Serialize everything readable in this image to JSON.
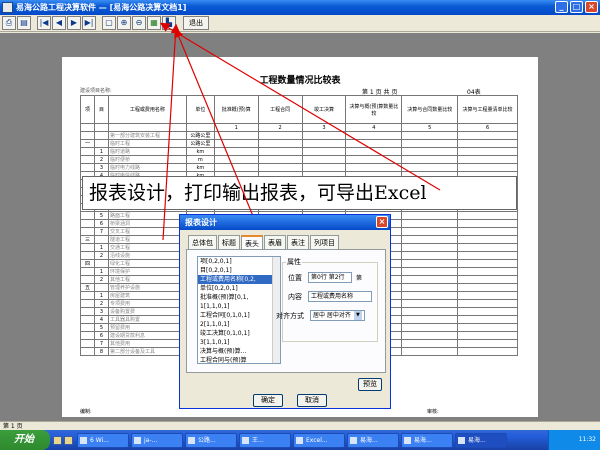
{
  "window": {
    "title": "易海公路工程决算软件 — [易海公路决算文档1]",
    "controls": [
      "_",
      "□",
      "×"
    ]
  },
  "toolbar": {
    "buttons": [
      {
        "name": "print-button",
        "glyph": "⎙"
      },
      {
        "name": "printer-setup-button",
        "glyph": "▤"
      },
      {
        "name": "first-page-button",
        "glyph": "|◀"
      },
      {
        "name": "prev-page-button",
        "glyph": "◀"
      },
      {
        "name": "next-page-button",
        "glyph": "▶"
      },
      {
        "name": "last-page-button",
        "glyph": "▶|"
      },
      {
        "name": "page-view-button",
        "glyph": "▢"
      },
      {
        "name": "zoom-in-button",
        "glyph": "⊕"
      },
      {
        "name": "zoom-out-button",
        "glyph": "⊖"
      },
      {
        "name": "export-excel-button",
        "glyph": "▦"
      },
      {
        "name": "report-design-button",
        "glyph": "▙"
      }
    ],
    "exit_label": "退出"
  },
  "report": {
    "title": "工程数量情况比较表",
    "subtitle": "第 1 页 共 页",
    "unit": "04表",
    "left_note": "建设项目名称:",
    "headers": [
      "项",
      "目",
      "工程或费用名称",
      "单位",
      "批准概(预)算",
      "工程合同",
      "竣工决算",
      "决算与概(预)算数量比较",
      "决算与合同数量比较",
      "决算与工程量清单比较"
    ],
    "col_numbers": [
      "",
      "",
      "",
      "",
      "1",
      "2",
      "3",
      "4",
      "5",
      "6"
    ],
    "rows": [
      [
        "",
        "",
        "第一部分建筑安装工程",
        "公路公里",
        "",
        "",
        "",
        "",
        "",
        ""
      ],
      [
        "一",
        "",
        "临时工程",
        "公路公里",
        "",
        "",
        "",
        "",
        "",
        ""
      ],
      [
        "",
        "1",
        "临时道路",
        "km",
        "",
        "",
        "",
        "",
        "",
        ""
      ],
      [
        "",
        "2",
        "临时便桥",
        "m",
        "",
        "",
        "",
        "",
        "",
        ""
      ],
      [
        "",
        "3",
        "临时电力线路",
        "km",
        "",
        "",
        "",
        "",
        "",
        ""
      ],
      [
        "",
        "4",
        "临时电信线路",
        "km",
        "",
        "",
        "",
        "",
        "",
        ""
      ]
    ],
    "lower_rows": [
      [
        "",
        "5",
        "路面工程",
        "",
        "",
        "",
        "",
        "",
        "",
        ""
      ],
      [
        "",
        "6",
        "桥梁涵洞",
        "",
        "",
        "",
        "",
        "",
        "",
        ""
      ],
      [
        "",
        "7",
        "交叉工程",
        "",
        "",
        "",
        "",
        "",
        "",
        ""
      ],
      [
        "三",
        "",
        "隧道工程",
        "",
        "",
        "",
        "",
        "",
        "",
        ""
      ],
      [
        "",
        "1",
        "交通工程",
        "",
        "",
        "",
        "",
        "",
        "",
        ""
      ],
      [
        "",
        "2",
        "沿线设施",
        "",
        "",
        "",
        "",
        "",
        "",
        ""
      ],
      [
        "四",
        "",
        "绿化工程",
        "",
        "",
        "",
        "",
        "",
        "",
        ""
      ],
      [
        "",
        "1",
        "环境保护",
        "",
        "",
        "",
        "",
        "",
        "",
        ""
      ],
      [
        "",
        "2",
        "其他工程",
        "",
        "",
        "",
        "",
        "",
        "",
        ""
      ],
      [
        "五",
        "",
        "管理养护设施",
        "",
        "",
        "",
        "",
        "",
        "",
        ""
      ],
      [
        "",
        "1",
        "房屋建筑",
        "",
        "",
        "",
        "",
        "",
        "",
        ""
      ],
      [
        "",
        "2",
        "专项费用",
        "",
        "",
        "",
        "",
        "",
        "",
        ""
      ],
      [
        "",
        "3",
        "设备购置费",
        "",
        "",
        "",
        "",
        "",
        "",
        ""
      ],
      [
        "",
        "4",
        "工具器具购置",
        "",
        "",
        "",
        "",
        "",
        "",
        ""
      ],
      [
        "",
        "5",
        "预留费用",
        "",
        "",
        "",
        "",
        "",
        "",
        ""
      ],
      [
        "",
        "6",
        "建设期贷款利息",
        "",
        "",
        "",
        "",
        "",
        "",
        ""
      ],
      [
        "",
        "7",
        "其他费用",
        "",
        "",
        "",
        "",
        "",
        "",
        ""
      ],
      [
        "",
        "8",
        "第二部分设备及工具",
        "",
        "",
        "",
        "",
        "",
        "",
        ""
      ]
    ],
    "footer_left": "编制:",
    "footer_right": "审核:"
  },
  "banner": {
    "text": "报表设计，打印输出报表，可导出Excel"
  },
  "dialog": {
    "title": "报表设计",
    "close": "×",
    "tabs": [
      "总体包",
      "标题",
      "表头",
      "表眉",
      "表注",
      "列项目"
    ],
    "active_tab": 2,
    "tree_items": [
      "项[0,2,0,1]",
      "目[0,2,0,1]",
      "工程或费用名称[0,2,",
      "单位[0,2,0,1]",
      "批准概(预)算[0,1,",
      "1[1,1,0,1]",
      "工程合同[0,1,0,1]",
      "2[1,1,0,1]",
      "竣工决算[0,1,0,1]",
      "3[1,1,0,1]",
      "决算与概(预)算...",
      "工程合同与(预)算"
    ],
    "selected_index": 2,
    "properties": {
      "legend": "属性",
      "position_label": "位置",
      "position_value": "第0行 第2行",
      "position_unit": "第",
      "content_label": "内容",
      "content_value": "工程或费用名称",
      "align_label": "对齐方式",
      "align_value": "居中  居中对齐"
    },
    "apply_label": "确定",
    "ok_label": "确定",
    "cancel_label": "取消",
    "browse_label": "预览"
  },
  "statusbar": {
    "text": "第 1 页"
  },
  "taskbar": {
    "start_label": "开始",
    "tasks": [
      "6 Wi...",
      "ja-...",
      "公路...",
      "王...",
      "Excel...",
      "易海...",
      "易海...",
      "易海..."
    ],
    "clock": "11:32"
  },
  "colors": {
    "annotation_arrow": "#e00000",
    "title_blue": "#0a5bd5",
    "selection": "#316ac5"
  }
}
